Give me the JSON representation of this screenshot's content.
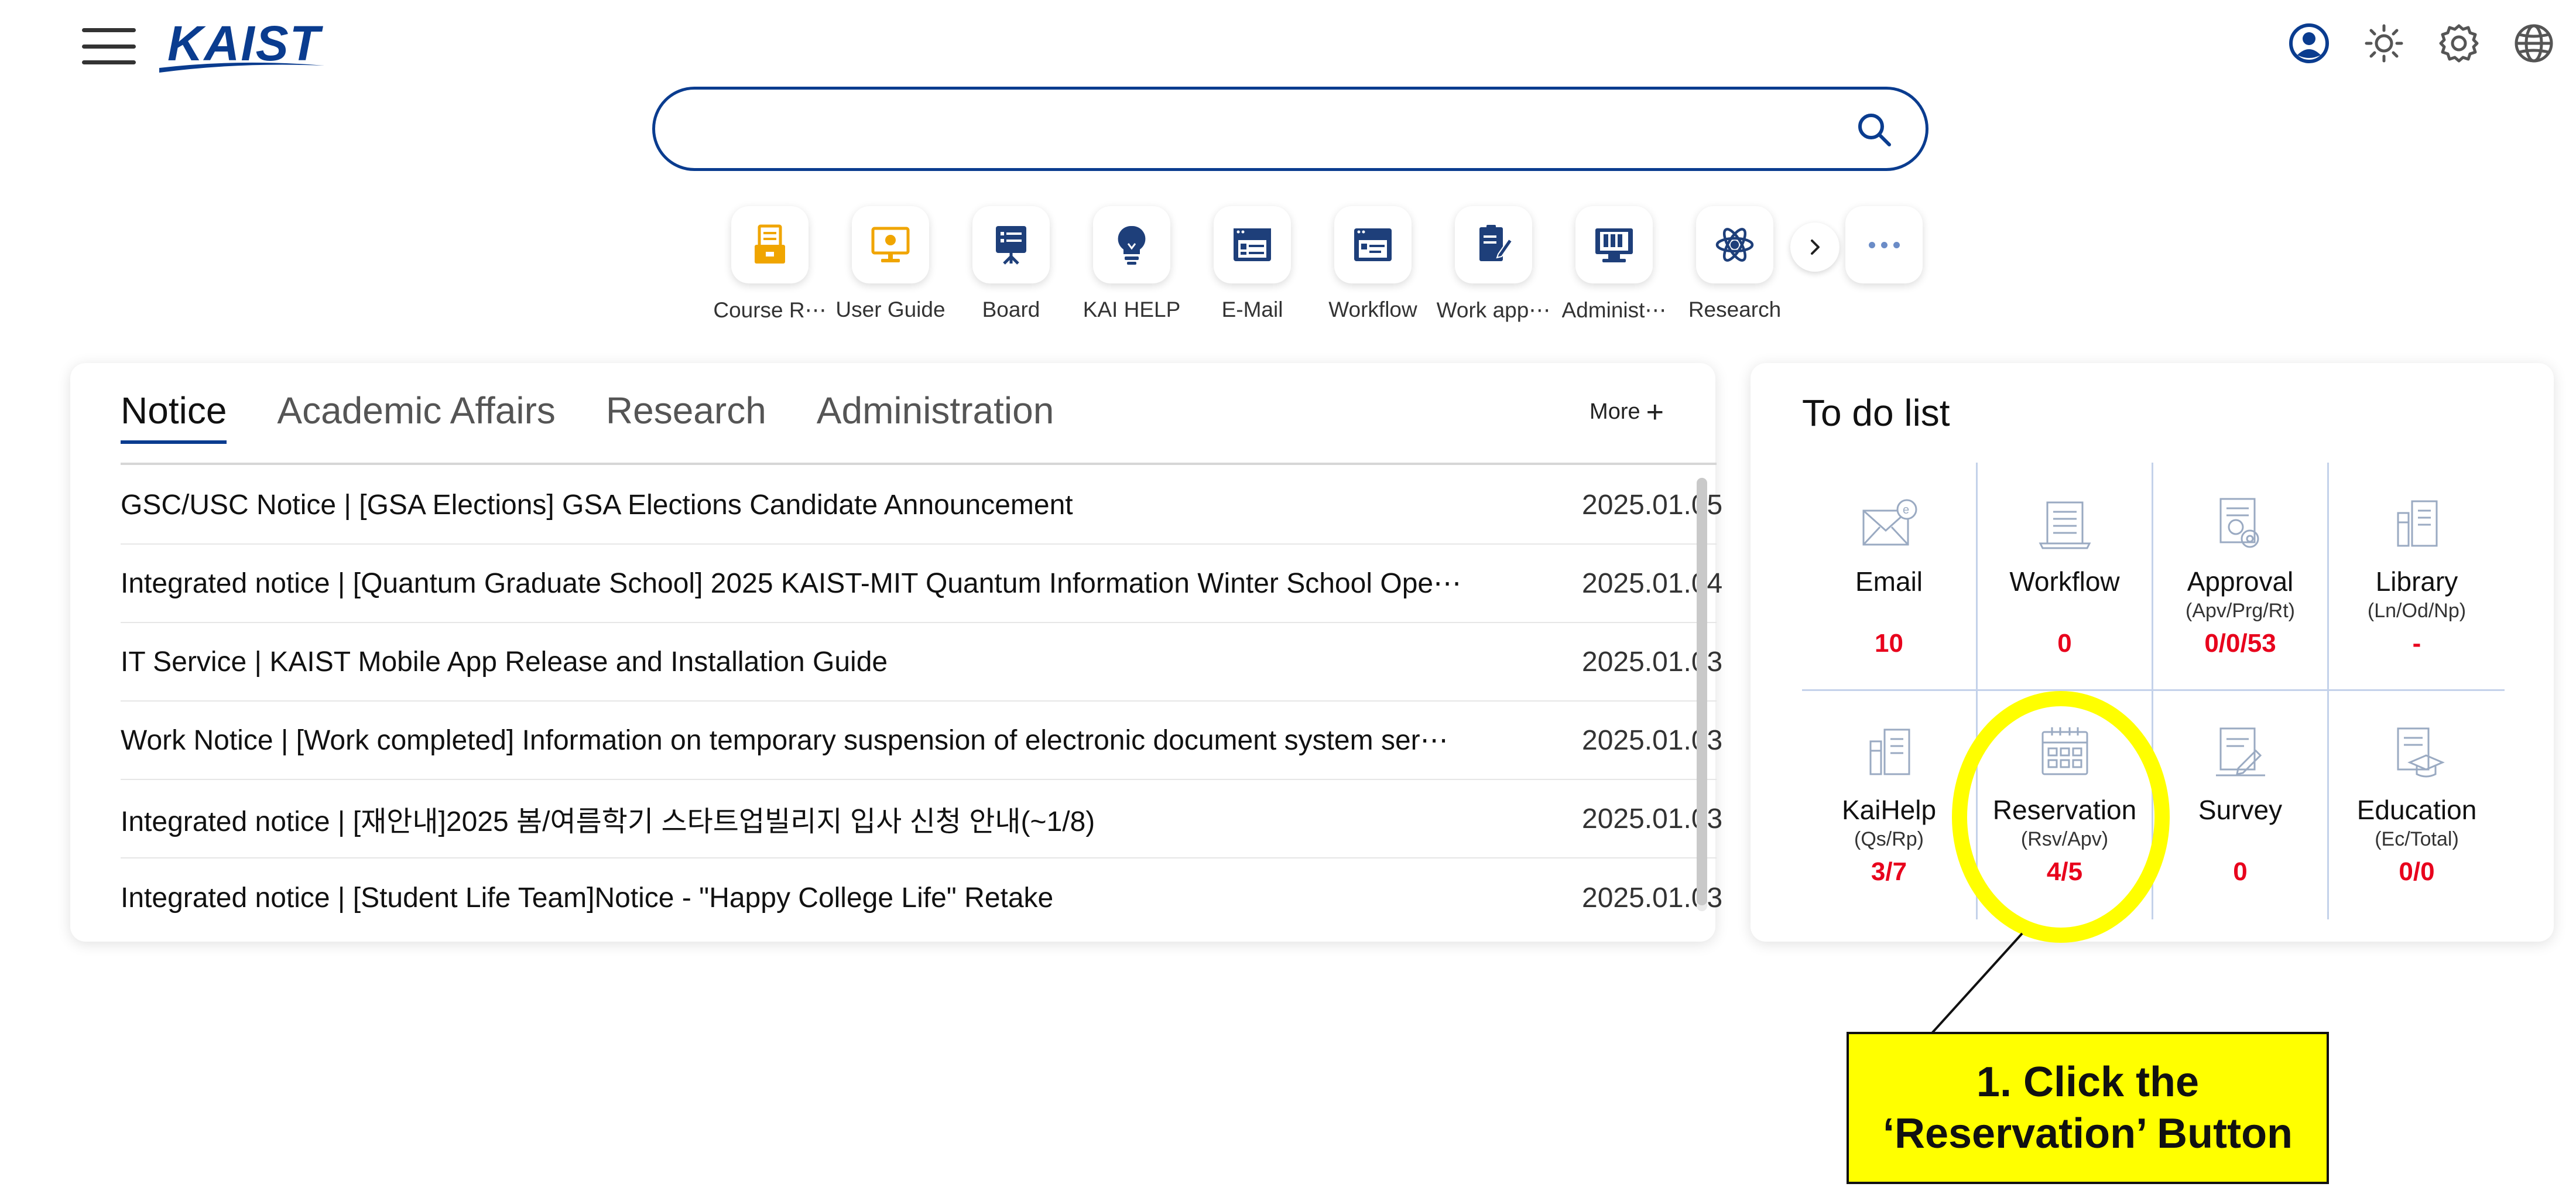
{
  "header": {
    "logo_text": "KAIST",
    "top_icons": [
      "user-icon",
      "sun-icon",
      "gear-icon",
      "globe-icon"
    ]
  },
  "search": {
    "value": "",
    "placeholder": ""
  },
  "shortcuts": [
    {
      "label": "Course R⋯",
      "icon": "course-registration-icon",
      "color": "#f0a500"
    },
    {
      "label": "User Guide",
      "icon": "user-guide-icon",
      "color": "#f0a500"
    },
    {
      "label": "Board",
      "icon": "board-icon",
      "color": "#1e3f7a"
    },
    {
      "label": "KAI HELP",
      "icon": "lightbulb-icon",
      "color": "#1e3f7a"
    },
    {
      "label": "E-Mail",
      "icon": "email-icon",
      "color": "#1e3f7a"
    },
    {
      "label": "Workflow",
      "icon": "workflow-icon",
      "color": "#1e3f7a"
    },
    {
      "label": "Work app⋯",
      "icon": "work-approval-icon",
      "color": "#1e3f7a"
    },
    {
      "label": "Administ⋯",
      "icon": "administration-icon",
      "color": "#1e3f7a"
    },
    {
      "label": "Research",
      "icon": "atom-icon",
      "color": "#1e3f7a"
    }
  ],
  "notice": {
    "tabs": [
      "Notice",
      "Academic Affairs",
      "Research",
      "Administration"
    ],
    "active_tab": "Notice",
    "more_label": "More",
    "items": [
      {
        "title": "GSC/USC Notice | [GSA Elections] GSA Elections Candidate Announcement",
        "date": "2025.01.05"
      },
      {
        "title": "Integrated notice | [Quantum Graduate School] 2025 KAIST-MIT Quantum Information Winter School Ope⋯",
        "date": "2025.01.04"
      },
      {
        "title": "IT Service | KAIST Mobile App Release and Installation Guide",
        "date": "2025.01.03"
      },
      {
        "title": "Work Notice | [Work completed] Information on temporary suspension of electronic document system ser⋯",
        "date": "2025.01.03"
      },
      {
        "title": "Integrated notice | [재안내]2025 봄/여름학기 스타트업빌리지 입사 신청 안내(~1/8)",
        "date": "2025.01.03"
      },
      {
        "title": "Integrated notice | [Student Life Team]Notice - \"Happy College Life\" Retake",
        "date": "2025.01.03"
      }
    ]
  },
  "todo": {
    "title": "To do list",
    "items": [
      {
        "name": "Email",
        "sub": "",
        "count": "10",
        "icon": "email-icon"
      },
      {
        "name": "Workflow",
        "sub": "",
        "count": "0",
        "icon": "workflow-icon"
      },
      {
        "name": "Approval",
        "sub": "(Apv/Prg/Rt)",
        "count": "0/0/53",
        "icon": "approval-icon"
      },
      {
        "name": "Library",
        "sub": "(Ln/Od/Np)",
        "count": "-",
        "icon": "library-icon"
      },
      {
        "name": "KaiHelp",
        "sub": "(Qs/Rp)",
        "count": "3/7",
        "icon": "kaihelp-icon"
      },
      {
        "name": "Reservation",
        "sub": "(Rsv/Apv)",
        "count": "4/5",
        "icon": "calendar-icon"
      },
      {
        "name": "Survey",
        "sub": "",
        "count": "0",
        "icon": "survey-icon"
      },
      {
        "name": "Education",
        "sub": "(Ec/Total)",
        "count": "0/0",
        "icon": "education-icon"
      }
    ]
  },
  "annotation": {
    "line1": "1. Click the",
    "line2": "‘Reservation’ Button",
    "color": "#ffff00"
  },
  "colors": {
    "brand": "#0a3c8f",
    "count_red": "#e8001c",
    "highlight": "#ffff00"
  }
}
